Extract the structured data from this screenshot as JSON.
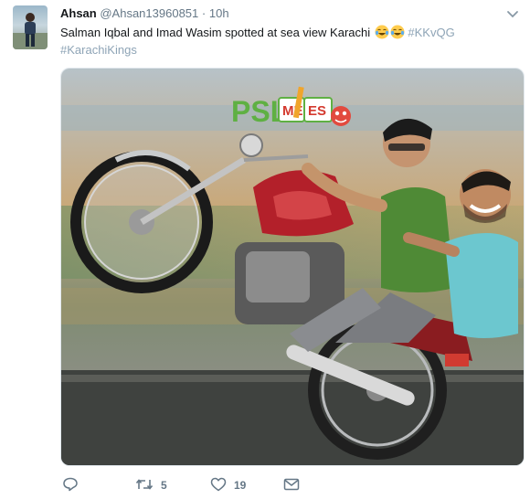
{
  "tweet": {
    "author": {
      "name": "Ahsan",
      "handle": "@Ahsan13960851",
      "separator": "·",
      "time": "10h"
    },
    "text": {
      "body": "Salman Iqbal and Imad Wasim spotted at sea view Karachi",
      "emojis": [
        "face-with-tears-of-joy",
        "face-with-tears-of-joy"
      ],
      "hashtags": [
        "#KKvQG",
        "#KarachiKings"
      ]
    },
    "media": {
      "description_icon": "image",
      "logo": {
        "part1": "PSL",
        "part2": "ME",
        "part3": "ES"
      }
    },
    "actions": {
      "reply": {
        "icon": "reply-icon",
        "count": ""
      },
      "retweet": {
        "icon": "retweet-icon",
        "count": "5"
      },
      "like": {
        "icon": "heart-icon",
        "count": "19"
      },
      "dm": {
        "icon": "envelope-icon",
        "count": ""
      }
    }
  },
  "colors": {
    "text": "#14171a",
    "muted": "#657786",
    "hashtag": "#8ea4b6",
    "border": "#e1e8ed"
  }
}
